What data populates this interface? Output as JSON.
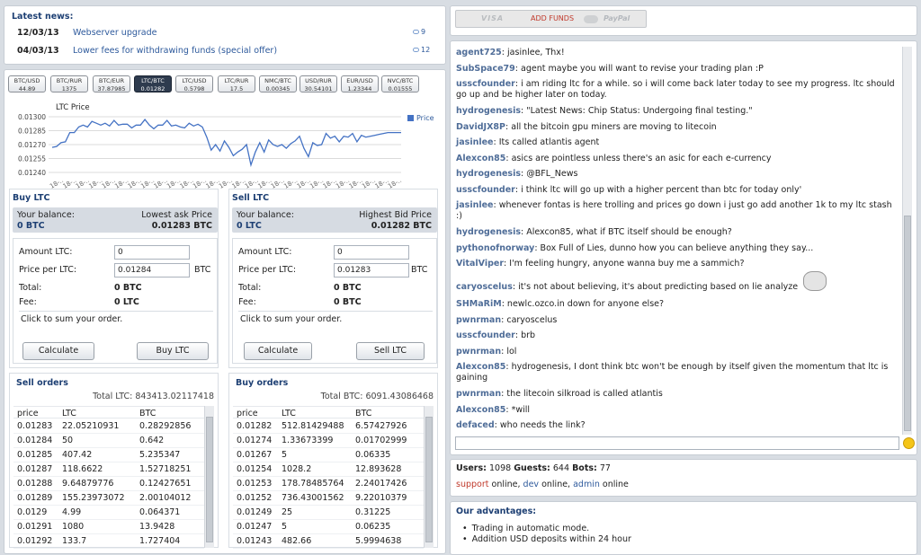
{
  "news": {
    "title": "Latest news:",
    "items": [
      {
        "date": "12/03/13",
        "text": "Webserver upgrade",
        "comments": "9"
      },
      {
        "date": "04/03/13",
        "text": "Lower fees for withdrawing funds (special offer)",
        "comments": "12"
      }
    ]
  },
  "pairs": [
    {
      "name": "BTC/USD",
      "price": "44.89"
    },
    {
      "name": "BTC/RUR",
      "price": "1375"
    },
    {
      "name": "BTC/EUR",
      "price": "37.87985"
    },
    {
      "name": "LTC/BTC",
      "price": "0.01282"
    },
    {
      "name": "LTC/USD",
      "price": "0.5798"
    },
    {
      "name": "LTC/RUR",
      "price": "17.5"
    },
    {
      "name": "NMC/BTC",
      "price": "0.00345"
    },
    {
      "name": "USD/RUR",
      "price": "30.54101"
    },
    {
      "name": "EUR/USD",
      "price": "1.23344"
    },
    {
      "name": "NVC/BTC",
      "price": "0.01555"
    }
  ],
  "chart_data": {
    "type": "line",
    "title": "LTC Price",
    "series": [
      {
        "name": "Price",
        "values": [
          0.01267,
          0.01268,
          0.01272,
          0.01273,
          0.01283,
          0.01283,
          0.01289,
          0.01291,
          0.01289,
          0.01295,
          0.01293,
          0.01291,
          0.01293,
          0.0129,
          0.01296,
          0.01291,
          0.01292,
          0.01292,
          0.01288,
          0.01291,
          0.01291,
          0.01297,
          0.01291,
          0.01287,
          0.01291,
          0.01291,
          0.01296,
          0.0129,
          0.01291,
          0.01289,
          0.01288,
          0.01293,
          0.0129,
          0.01292,
          0.01289,
          0.01278,
          0.01264,
          0.0127,
          0.01263,
          0.01274,
          0.01267,
          0.01258,
          0.01262,
          0.01265,
          0.0127,
          0.01248,
          0.01262,
          0.01272,
          0.01262,
          0.01275,
          0.0127,
          0.01268,
          0.0127,
          0.01266,
          0.01271,
          0.01274,
          0.01279,
          0.01266,
          0.01257,
          0.01272,
          0.01269,
          0.0127,
          0.01282,
          0.01277,
          0.01279,
          0.01273,
          0.01279,
          0.01278,
          0.01282,
          0.01273,
          0.0128,
          0.01278,
          0.01279,
          0.0128,
          0.01281,
          0.01282,
          0.01283,
          0.01283,
          0.01283,
          0.01283
        ]
      }
    ],
    "yticks": [
      "0.01300",
      "0.01285",
      "0.01270",
      "0.01255",
      "0.01240"
    ],
    "ylim": [
      0.0124,
      0.013
    ],
    "xtick_label": "18-..",
    "xtick_count": 27,
    "legend": "Price",
    "legend_position": "right"
  },
  "buy": {
    "title": "Buy LTC",
    "balance_label": "Your balance:",
    "balance_value": "0 BTC",
    "price_label": "Lowest ask Price",
    "price_value": "0.01283 BTC",
    "amount_label": "Amount LTC:",
    "amount_value": "0",
    "ppu_label": "Price per LTC:",
    "ppu_value": "0.01284",
    "ppu_suffix": "BTC",
    "total_label": "Total:",
    "total_value": "0 BTC",
    "fee_label": "Fee:",
    "fee_value": "0 LTC",
    "hint": "Click to sum your order.",
    "calc": "Calculate",
    "action": "Buy LTC"
  },
  "sell": {
    "title": "Sell LTC",
    "balance_label": "Your balance:",
    "balance_value": "0 LTC",
    "price_label": "Highest Bid Price",
    "price_value": "0.01282 BTC",
    "amount_label": "Amount LTC:",
    "amount_value": "0",
    "ppu_label": "Price per LTC:",
    "ppu_value": "0.01283",
    "ppu_suffix": "BTC",
    "total_label": "Total:",
    "total_value": "0 BTC",
    "fee_label": "Fee:",
    "fee_value": "0 BTC",
    "hint": "Click to sum your order.",
    "calc": "Calculate",
    "action": "Sell LTC"
  },
  "sell_orders": {
    "title": "Sell orders",
    "total": "Total LTC: 843413.02117418",
    "headers": [
      "price",
      "LTC",
      "BTC"
    ],
    "rows": [
      [
        "0.01283",
        "22.05210931",
        "0.28292856"
      ],
      [
        "0.01284",
        "50",
        "0.642"
      ],
      [
        "0.01285",
        "407.42",
        "5.235347"
      ],
      [
        "0.01287",
        "118.6622",
        "1.52718251"
      ],
      [
        "0.01288",
        "9.64879776",
        "0.12427651"
      ],
      [
        "0.01289",
        "155.23973072",
        "2.00104012"
      ],
      [
        "0.0129",
        "4.99",
        "0.064371"
      ],
      [
        "0.01291",
        "1080",
        "13.9428"
      ],
      [
        "0.01292",
        "133.7",
        "1.727404"
      ]
    ]
  },
  "buy_orders": {
    "title": "Buy orders",
    "total": "Total BTC: 6091.43086468",
    "headers": [
      "price",
      "LTC",
      "BTC"
    ],
    "rows": [
      [
        "0.01282",
        "512.81429488",
        "6.57427926"
      ],
      [
        "0.01274",
        "1.33673399",
        "0.01702999"
      ],
      [
        "0.01267",
        "5",
        "0.06335"
      ],
      [
        "0.01254",
        "1028.2",
        "12.893628"
      ],
      [
        "0.01253",
        "178.78485764",
        "2.24017426"
      ],
      [
        "0.01252",
        "736.43001562",
        "9.22010379"
      ],
      [
        "0.01249",
        "25",
        "0.31225"
      ],
      [
        "0.01247",
        "5",
        "0.06235"
      ],
      [
        "0.01243",
        "482.66",
        "5.9994638"
      ]
    ]
  },
  "addfunds": {
    "visa": "VISA",
    "label": "ADD FUNDS",
    "paypal": "PayPal"
  },
  "chat": [
    {
      "name": "agent725",
      "text": "jasinlee, Thx!"
    },
    {
      "name": "SubSpace79",
      "text": "agent maybe you will want to revise your trading plan :P"
    },
    {
      "name": "usscfounder",
      "text": "i am riding ltc for a while. so i will come back later today to see my progress. ltc should",
      "text2": "go up and be higher later on today."
    },
    {
      "name": "hydrogenesis",
      "text": "\"Latest News: Chip Status: Undergoing final testing.\""
    },
    {
      "name": "DavidJX8P",
      "text": "all the bitcoin gpu miners are moving to litecoin"
    },
    {
      "name": "jasinlee",
      "text": "Its called atlantis agent"
    },
    {
      "name": "Alexcon85",
      "text": "asics are pointless unless there's an asic for each e-currency"
    },
    {
      "name": "hydrogenesis",
      "text": "@BFL_News"
    },
    {
      "name": "usscfounder",
      "text": "i think ltc will go up with a higher percent than btc for today only'"
    },
    {
      "name": "jasinlee",
      "text": "whenever fontas is here trolling and prices go down i just go add another 1k to my ltc stash",
      "text2": ":)"
    },
    {
      "name": "hydrogenesis",
      "text": "Alexcon85, what if BTC itself should be enough?"
    },
    {
      "name": "pythonofnorway",
      "text": "Box Full of Lies, dunno how you can believe anything they say..."
    },
    {
      "name": "VitalViper",
      "text": "I'm feeling hungry, anyone wanna buy me a sammich?"
    },
    {
      "name": "caryoscelus",
      "text": "it's not about believing, it's about predicting based on lie analyze"
    },
    {
      "name": "SHMaRiM",
      "text": "newlc.ozco.in down for anyone else?"
    },
    {
      "name": "pwnrman",
      "text": "caryoscelus"
    },
    {
      "name": "usscfounder",
      "text": "brb"
    },
    {
      "name": "pwnrman",
      "text": "lol"
    },
    {
      "name": "Alexcon85",
      "text": "hydrogenesis, I dont think btc won't be enough by itself given the momentum that ltc is",
      "text2": "gaining"
    },
    {
      "name": "pwnrman",
      "text": "the litecoin silkroad is called atlantis"
    },
    {
      "name": "Alexcon85",
      "text": "*will"
    },
    {
      "name": "defaced",
      "text": "who needs the link?"
    }
  ],
  "stats": {
    "users_label": "Users:",
    "users": "1098",
    "guests_label": "Guests:",
    "guests": "644",
    "bots_label": "Bots:",
    "bots": "77"
  },
  "online": {
    "support": "support",
    "support_status": "online,",
    "dev": "dev",
    "dev_status": "online,",
    "admin": "admin",
    "admin_status": "online"
  },
  "advantages": {
    "title": "Our advantages:",
    "items": [
      "Trading in automatic mode.",
      "Addition USD deposits within 24 hour"
    ]
  }
}
